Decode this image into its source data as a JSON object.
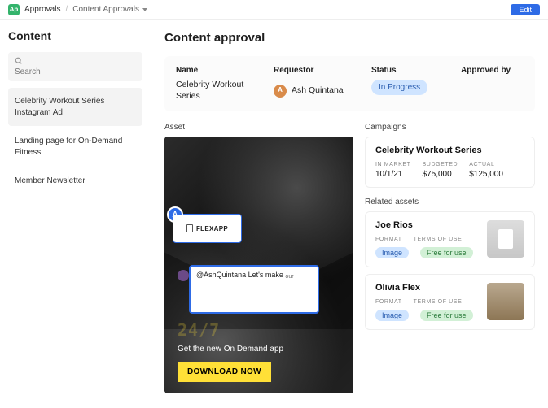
{
  "topbar": {
    "app_initials": "Ap",
    "crumb_root": "Approvals",
    "crumb_current": "Content Approvals",
    "edit_label": "Edit"
  },
  "sidebar": {
    "heading": "Content",
    "search_placeholder": "Search",
    "items": [
      {
        "label": "Celebrity Workout Series Instagram Ad",
        "active": true
      },
      {
        "label": "Landing page for On-Demand Fitness",
        "active": false
      },
      {
        "label": "Member Newsletter",
        "active": false
      }
    ]
  },
  "panel": {
    "heading": "Content approval",
    "info_labels": {
      "name": "Name",
      "requestor": "Requestor",
      "status": "Status",
      "approved_by": "Approved by"
    },
    "name_value": "Celebrity Workout Series",
    "requestor_name": "Ash Quintana",
    "requestor_initial": "A",
    "status_value": "In Progress",
    "approved_by_value": ""
  },
  "asset": {
    "section_label": "Asset",
    "annotation_badge": "A",
    "annotation_label": "FLEXAPP",
    "comment_text": "@AshQuintana Let's make ",
    "comment_sub": "our",
    "big_text": "24/7",
    "tagline": "Get the new On Demand app",
    "cta": "DOWNLOAD NOW"
  },
  "campaigns": {
    "section_label": "Campaigns",
    "title": "Celebrity Workout Series",
    "stats": [
      {
        "label": "in market",
        "value": "10/1/21"
      },
      {
        "label": "budgeted",
        "value": "$75,000"
      },
      {
        "label": "actual",
        "value": "$125,000"
      }
    ]
  },
  "related": {
    "section_label": "Related assets",
    "items": [
      {
        "name": "Joe Rios",
        "format_label": "format",
        "terms_label": "terms of use",
        "format_value": "Image",
        "terms_value": "Free for use"
      },
      {
        "name": "Olivia Flex",
        "format_label": "format",
        "terms_label": "terms of use",
        "format_value": "Image",
        "terms_value": "Free for use"
      }
    ]
  }
}
